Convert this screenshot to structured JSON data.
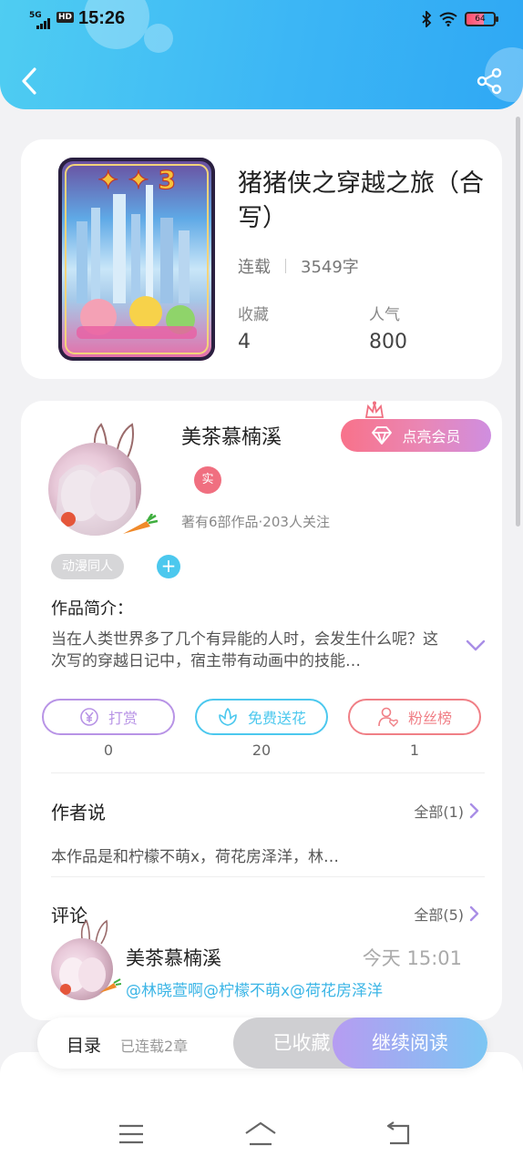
{
  "status_bar": {
    "time": "15:26",
    "network": "5G",
    "hd": "HD",
    "battery": "64"
  },
  "book": {
    "title": "猪猪侠之穿越之旅（合写）",
    "status": "连载",
    "word_count": "3549字",
    "favorites_label": "收藏",
    "favorites_value": "4",
    "popularity_label": "人气",
    "popularity_value": "800"
  },
  "author": {
    "name": "美茶慕楠溪",
    "vip_button": "点亮会员",
    "real_badge": "实",
    "stats": "著有6部作品·203人关注",
    "tag": "动漫同人",
    "add_tag": "+"
  },
  "intro": {
    "label": "作品简介：",
    "text": "当在人类世界多了几个有异能的人时，会发生什么呢？这次写的穿越日记中，宿主带有动画中的技能…"
  },
  "actions": [
    {
      "label": "打赏",
      "count": "0",
      "color": "#b894e6",
      "icon": "yuan-icon"
    },
    {
      "label": "免费送花",
      "count": "20",
      "color": "#4cc8ee",
      "icon": "flower-icon"
    },
    {
      "label": "粉丝榜",
      "count": "1",
      "color": "#f07f86",
      "icon": "fan-icon"
    }
  ],
  "author_says": {
    "title": "作者说",
    "more": "全部(1)",
    "text": "本作品是和柠檬不萌x，荷花房泽洋，林…"
  },
  "comments": {
    "title": "评论",
    "more": "全部(5)",
    "items": [
      {
        "name": "美茶慕楠溪",
        "time": "今天 15:01",
        "text": "@林晓萱啊@柠檬不萌x@荷花房泽洋"
      }
    ]
  },
  "bottom_bar": {
    "toc": "目录",
    "chapters": "已连载2章",
    "collected": "已收藏",
    "read": "继续阅读"
  },
  "colors": {
    "header": "#3cb6f5",
    "accent_blue": "#4cc8ee",
    "accent_pink": "#f06f80"
  }
}
